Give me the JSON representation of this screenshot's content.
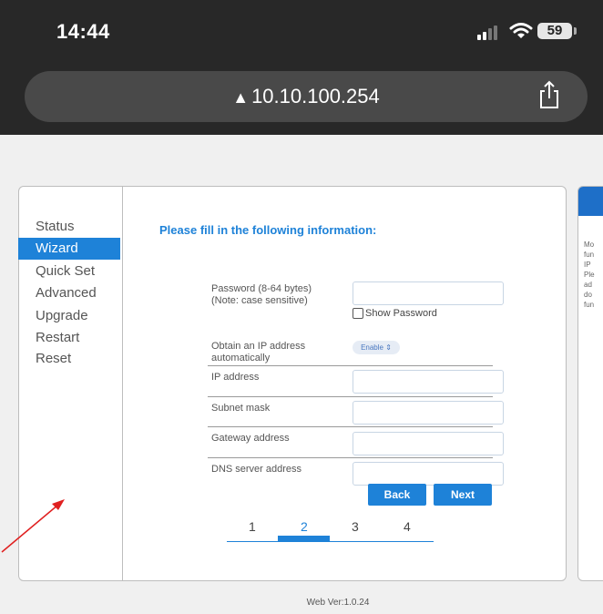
{
  "status_bar": {
    "time": "14:44",
    "battery": "59"
  },
  "browser": {
    "url": "10.10.100.254",
    "warning_icon": "warning-triangle-icon",
    "share_icon": "share-icon"
  },
  "sidebar": {
    "items": [
      {
        "label": "Status",
        "active": false
      },
      {
        "label": "Wizard",
        "active": true
      },
      {
        "label": "Quick Set",
        "active": false
      },
      {
        "label": "Advanced",
        "active": false
      },
      {
        "label": "Upgrade",
        "active": false
      },
      {
        "label": "Restart",
        "active": false
      },
      {
        "label": "Reset",
        "active": false
      }
    ]
  },
  "form": {
    "title": "Please fill in the following information:",
    "password_label_1": "Password (8-64 bytes)",
    "password_label_2": "(Note: case sensitive)",
    "password_value": "",
    "show_password_label": "Show Password",
    "show_password_checked": false,
    "obtain_ip_label_1": "Obtain an IP address",
    "obtain_ip_label_2": "automatically",
    "obtain_ip_value": "Enable",
    "ip_label": "IP address",
    "ip_value": "",
    "subnet_label": "Subnet mask",
    "subnet_value": "",
    "gateway_label": "Gateway address",
    "gateway_value": "",
    "dns_label": "DNS server address",
    "dns_value": "",
    "back_label": "Back",
    "next_label": "Next"
  },
  "steps": {
    "labels": [
      "1",
      "2",
      "3",
      "4"
    ],
    "current": "2"
  },
  "help_panel": {
    "text_lines": [
      "Mo",
      "fun",
      "IP",
      "Ple",
      "ad",
      "do",
      "fun"
    ]
  },
  "footer": {
    "version": "Web Ver:1.0.24"
  },
  "colors": {
    "accent": "#1e82d8",
    "annotation_arrow": "#e02020"
  }
}
